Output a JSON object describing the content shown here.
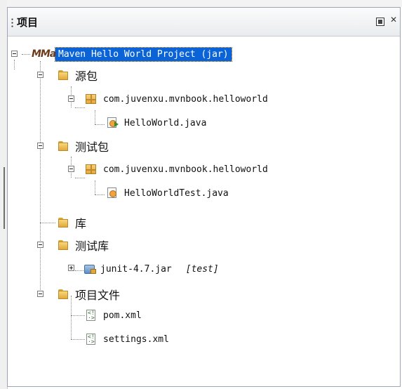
{
  "panel": {
    "title": "项目",
    "maximize_icon": "maximize-icon",
    "close_icon": "close-icon"
  },
  "tree": {
    "root": {
      "label": "Maven Hello World Project (jar)",
      "icon": "maven-project-icon"
    },
    "source_packages": {
      "label": "源包",
      "package": "com.juvenxu.mvnbook.helloworld",
      "file": "HelloWorld.java"
    },
    "test_packages": {
      "label": "测试包",
      "package": "com.juvenxu.mvnbook.helloworld",
      "file": "HelloWorldTest.java"
    },
    "libraries": {
      "label": "库"
    },
    "test_libraries": {
      "label": "测试库",
      "jar": "junit-4.7.jar",
      "scope": "[test]"
    },
    "project_files": {
      "label": "项目文件",
      "files": [
        "pom.xml",
        "settings.xml"
      ]
    }
  }
}
